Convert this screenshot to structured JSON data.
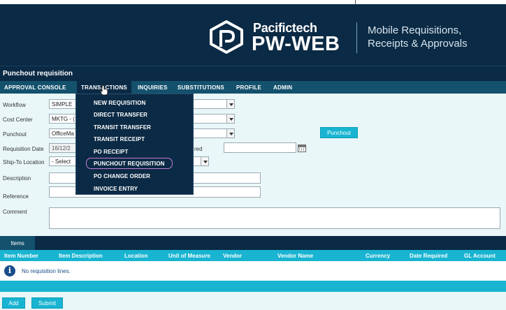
{
  "brand": {
    "company": "Pacifictech",
    "product": "PW-WEB",
    "tagline_line1": "Mobile Requisitions,",
    "tagline_line2": "Receipts & Approvals"
  },
  "page_title": "Punchout requisition",
  "nav": {
    "items": [
      {
        "label": "APPROVAL CONSOLE"
      },
      {
        "label": "TRANSACTIONS"
      },
      {
        "label": "INQUIRIES"
      },
      {
        "label": "SUBSTITUTIONS"
      },
      {
        "label": "PROFILE"
      },
      {
        "label": "ADMIN"
      }
    ],
    "active": "TRANSACTIONS"
  },
  "transactions_menu": {
    "items": [
      {
        "label": "NEW REQUISITION"
      },
      {
        "label": "DIRECT TRANSFER"
      },
      {
        "label": "TRANSIT TRANSFER"
      },
      {
        "label": "TRANSIT RECEIPT"
      },
      {
        "label": "PO RECEIPT"
      },
      {
        "label": "PUNCHOUT REQUISITION"
      },
      {
        "label": "PO CHANGE ORDER"
      },
      {
        "label": "INVOICE ENTRY"
      }
    ],
    "highlighted": "PUNCHOUT REQUISITION"
  },
  "form": {
    "workflow": {
      "label": "Workflow",
      "value": "SIMPLE"
    },
    "cost_center": {
      "label": "Cost Center",
      "value": "MKTG - ("
    },
    "punchout": {
      "label": "Punchout",
      "value": "OfficeMa"
    },
    "punchout_button": "Punchout",
    "requisition_date": {
      "label": "Requisition Date",
      "value": "16/12/2"
    },
    "date_required_label_fragment": "red",
    "date_required_value": "",
    "ship_to": {
      "label": "Ship-To Location",
      "value": "- Select"
    },
    "description": {
      "label": "Description",
      "value": ""
    },
    "reference": {
      "label": "Reference",
      "value": ""
    },
    "comment": {
      "label": "Comment",
      "value": ""
    }
  },
  "items_tab": "Items",
  "items_table": {
    "columns": [
      "Item Number",
      "Item Description",
      "Location",
      "Unit of Measure",
      "Vendor",
      "Vendor Name",
      "Currency",
      "Date Required",
      "GL Account"
    ],
    "empty_message": "No requisition lines."
  },
  "actions": {
    "add": "Add",
    "submit": "Submit"
  }
}
